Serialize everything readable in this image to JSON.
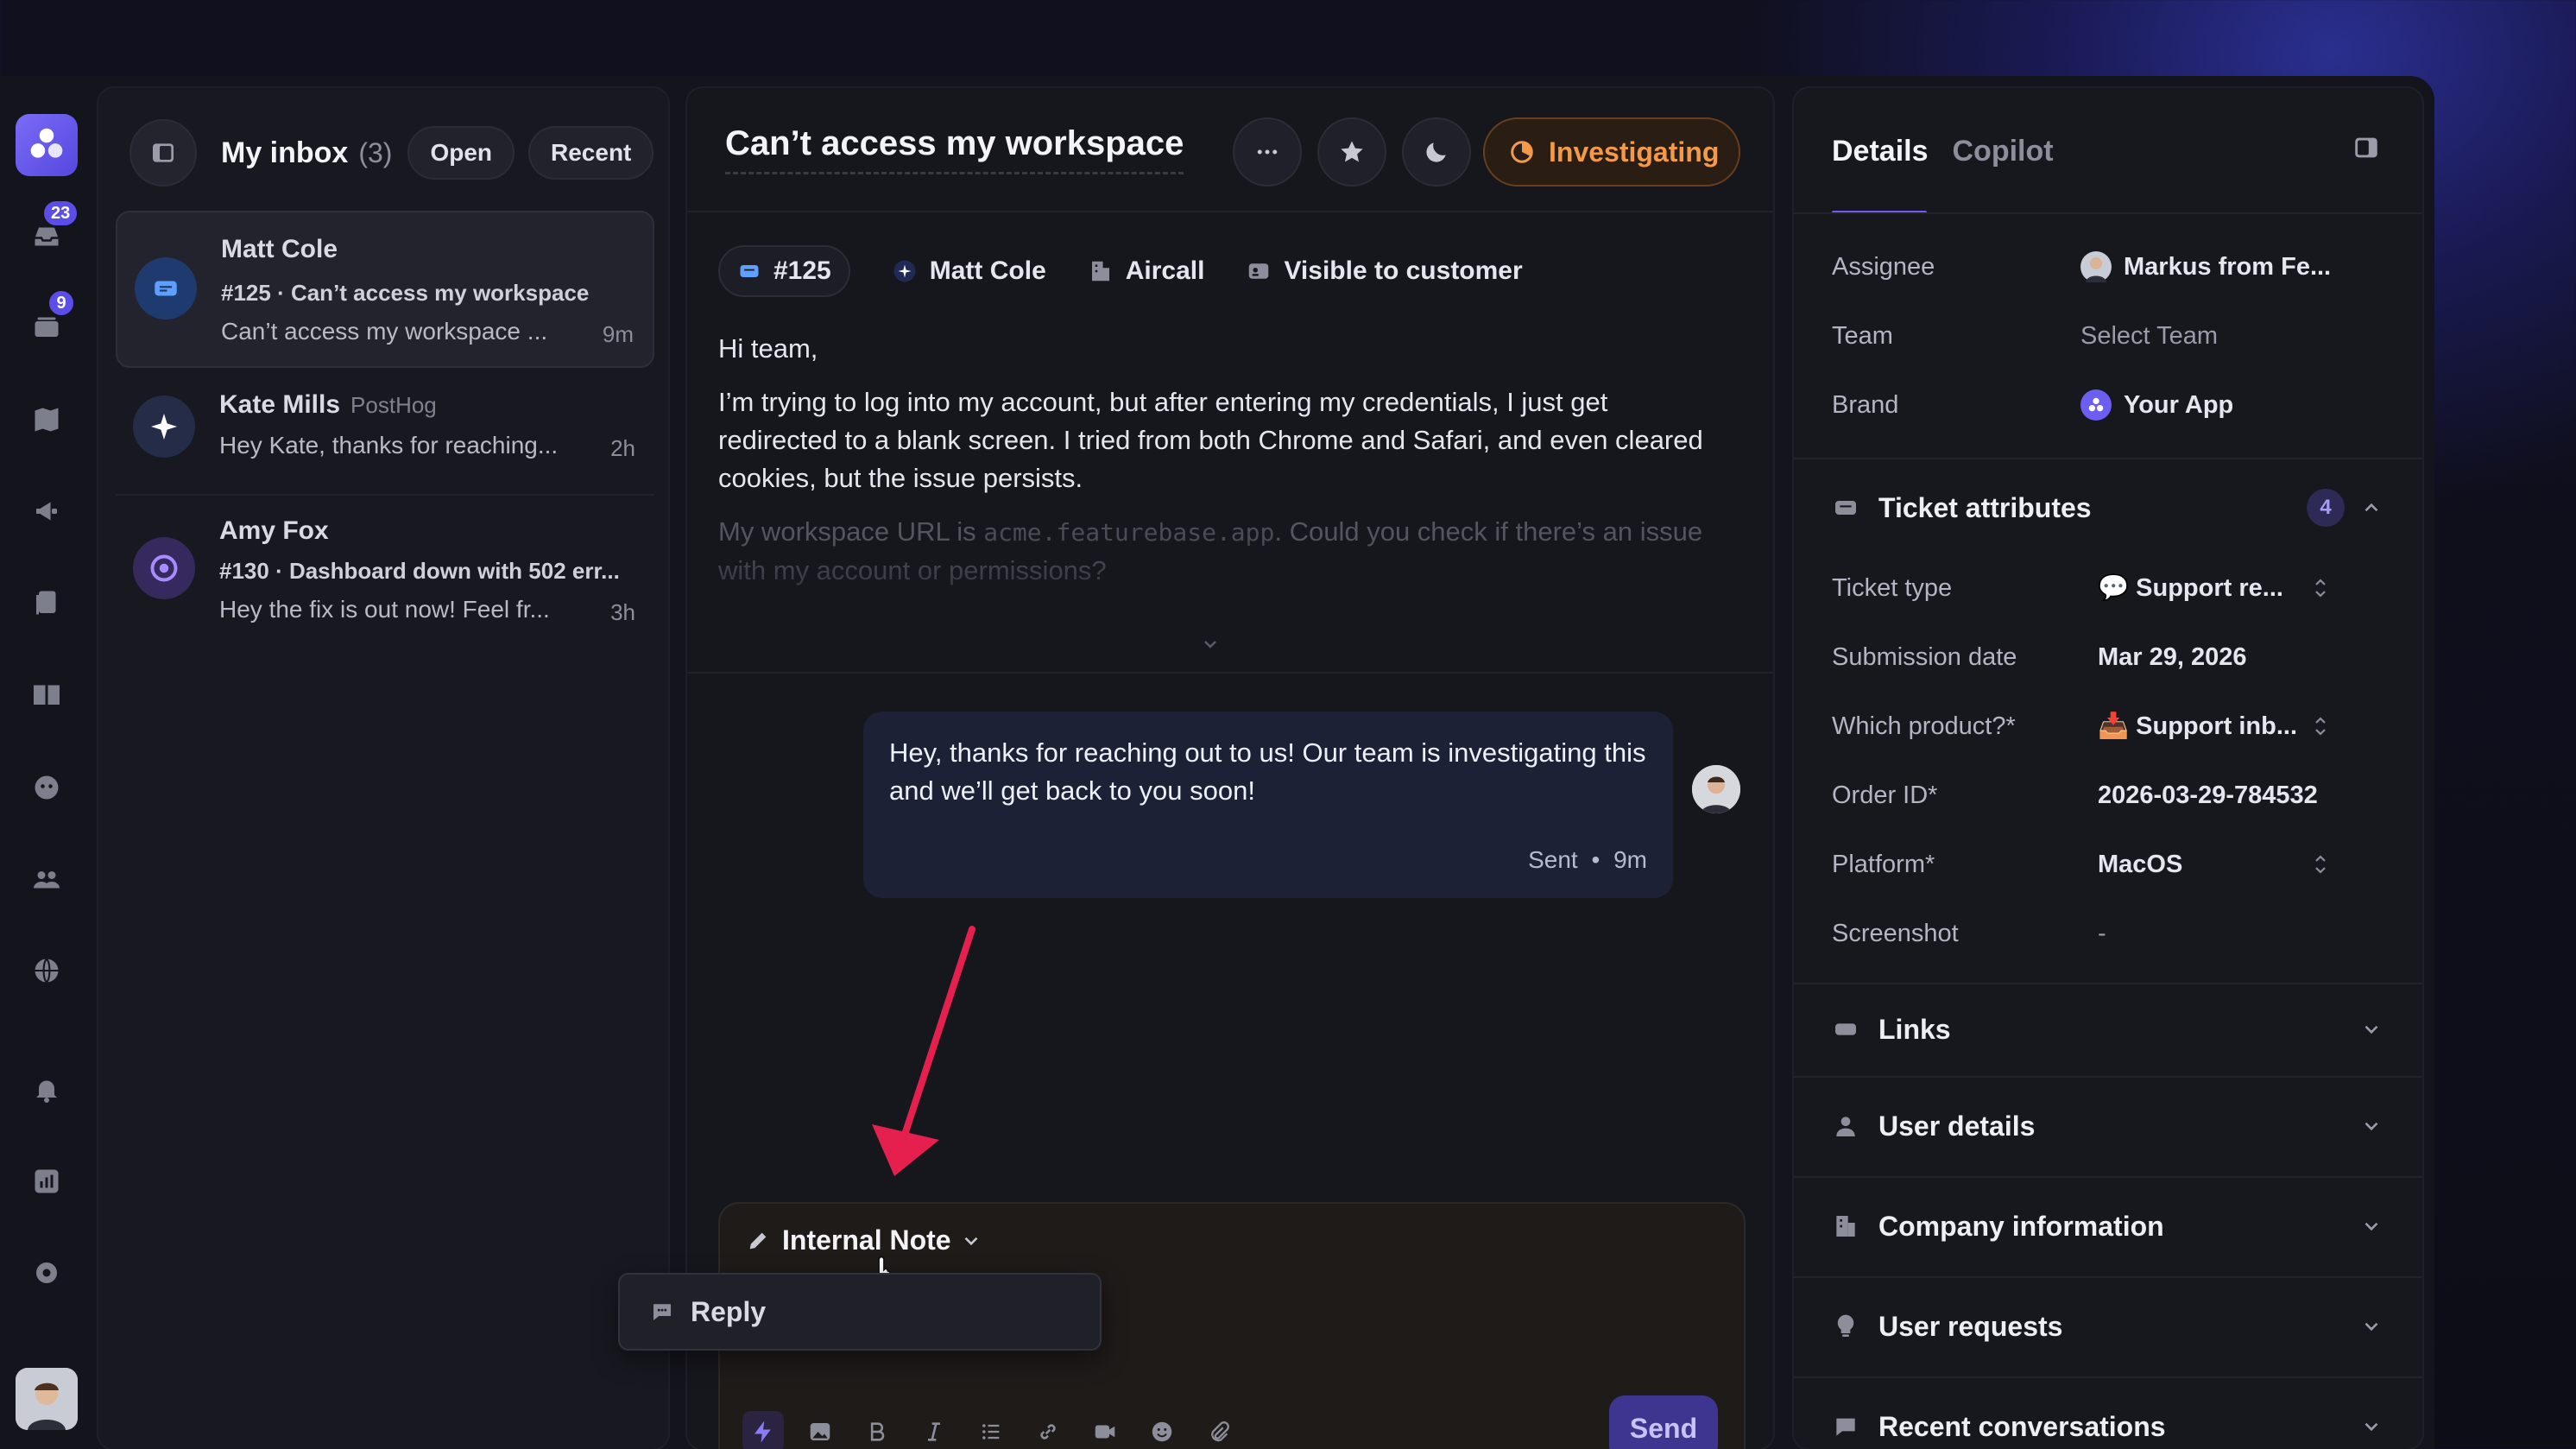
{
  "colors": {
    "accent": "#6b5ef0",
    "status": "#f29a4a",
    "badge": "#5b4ee8"
  },
  "rail": {
    "items": [
      {
        "icon": "inbox-icon",
        "badge": "23"
      },
      {
        "icon": "tickets-icon",
        "badge": "9"
      },
      {
        "icon": "roadmap-icon"
      },
      {
        "icon": "announcements-icon"
      },
      {
        "icon": "docs-icon"
      },
      {
        "icon": "help-center-icon"
      },
      {
        "icon": "ai-agent-icon"
      },
      {
        "icon": "users-icon"
      },
      {
        "icon": "globe-icon"
      },
      {
        "icon": "bell-icon"
      },
      {
        "icon": "analytics-icon"
      },
      {
        "icon": "gear-icon"
      }
    ]
  },
  "inbox": {
    "title": "My inbox",
    "count": "(3)",
    "filter_open": "Open",
    "filter_sort": "Recent",
    "conversations": [
      {
        "name": "Matt Cole",
        "org": "",
        "subject": "#125 · Can’t access my workspace",
        "preview": "Can’t access my workspace ...",
        "time": "9m",
        "icon": "ticket-icon"
      },
      {
        "name": "Kate Mills",
        "org": "PostHog",
        "subject": "",
        "preview": "Hey Kate, thanks for reaching...",
        "time": "2h",
        "icon": "sparkle-icon"
      },
      {
        "name": "Amy Fox",
        "org": "",
        "subject": "#130 · Dashboard down with 502 err...",
        "preview": "Hey the fix is out now! Feel fr...",
        "time": "3h",
        "icon": "target-icon"
      }
    ]
  },
  "conversation": {
    "title": "Can’t access my workspace",
    "status": "Investigating",
    "chips": {
      "ticket": "#125",
      "user": "Matt Cole",
      "company": "Aircall",
      "visibility": "Visible to customer"
    },
    "message": {
      "greeting": "Hi team,",
      "body": "I’m trying to log into my account, but after entering my credentials, I just get redirected to a blank screen. I tried from both Chrome and Safari, and even cleared cookies, but the issue persists.",
      "faded_pre": "My workspace URL is",
      "faded_code": "acme.featurebase.app",
      "faded_post": ". Could you check if there’s an issue with my account or permissions?"
    },
    "reply": {
      "text": "Hey, thanks for reaching out to us! Our team is investigating this and we’ll get back to you soon!",
      "status": "Sent",
      "time": "9m"
    },
    "composer": {
      "mode": "Internal Note",
      "send": "Send",
      "menu_option": "Reply"
    }
  },
  "details": {
    "tabs": [
      "Details",
      "Copilot"
    ],
    "assignee_label": "Assignee",
    "assignee_value": "Markus from Fe...",
    "team_label": "Team",
    "team_value": "Select Team",
    "brand_label": "Brand",
    "brand_value": "Your App",
    "ticket_attributes": {
      "title": "Ticket attributes",
      "count": "4",
      "ticket_type_label": "Ticket type",
      "ticket_type_value": "💬 Support re...",
      "submission_label": "Submission date",
      "submission_value": "Mar 29, 2026",
      "product_label": "Which product?*",
      "product_value": "📥 Support inb...",
      "order_label": "Order ID*",
      "order_value": "2026-03-29-784532",
      "platform_label": "Platform*",
      "platform_value": "MacOS",
      "screenshot_label": "Screenshot",
      "screenshot_value": "-"
    },
    "sections": [
      "Links",
      "User details",
      "Company information",
      "User requests",
      "Recent conversations"
    ]
  }
}
